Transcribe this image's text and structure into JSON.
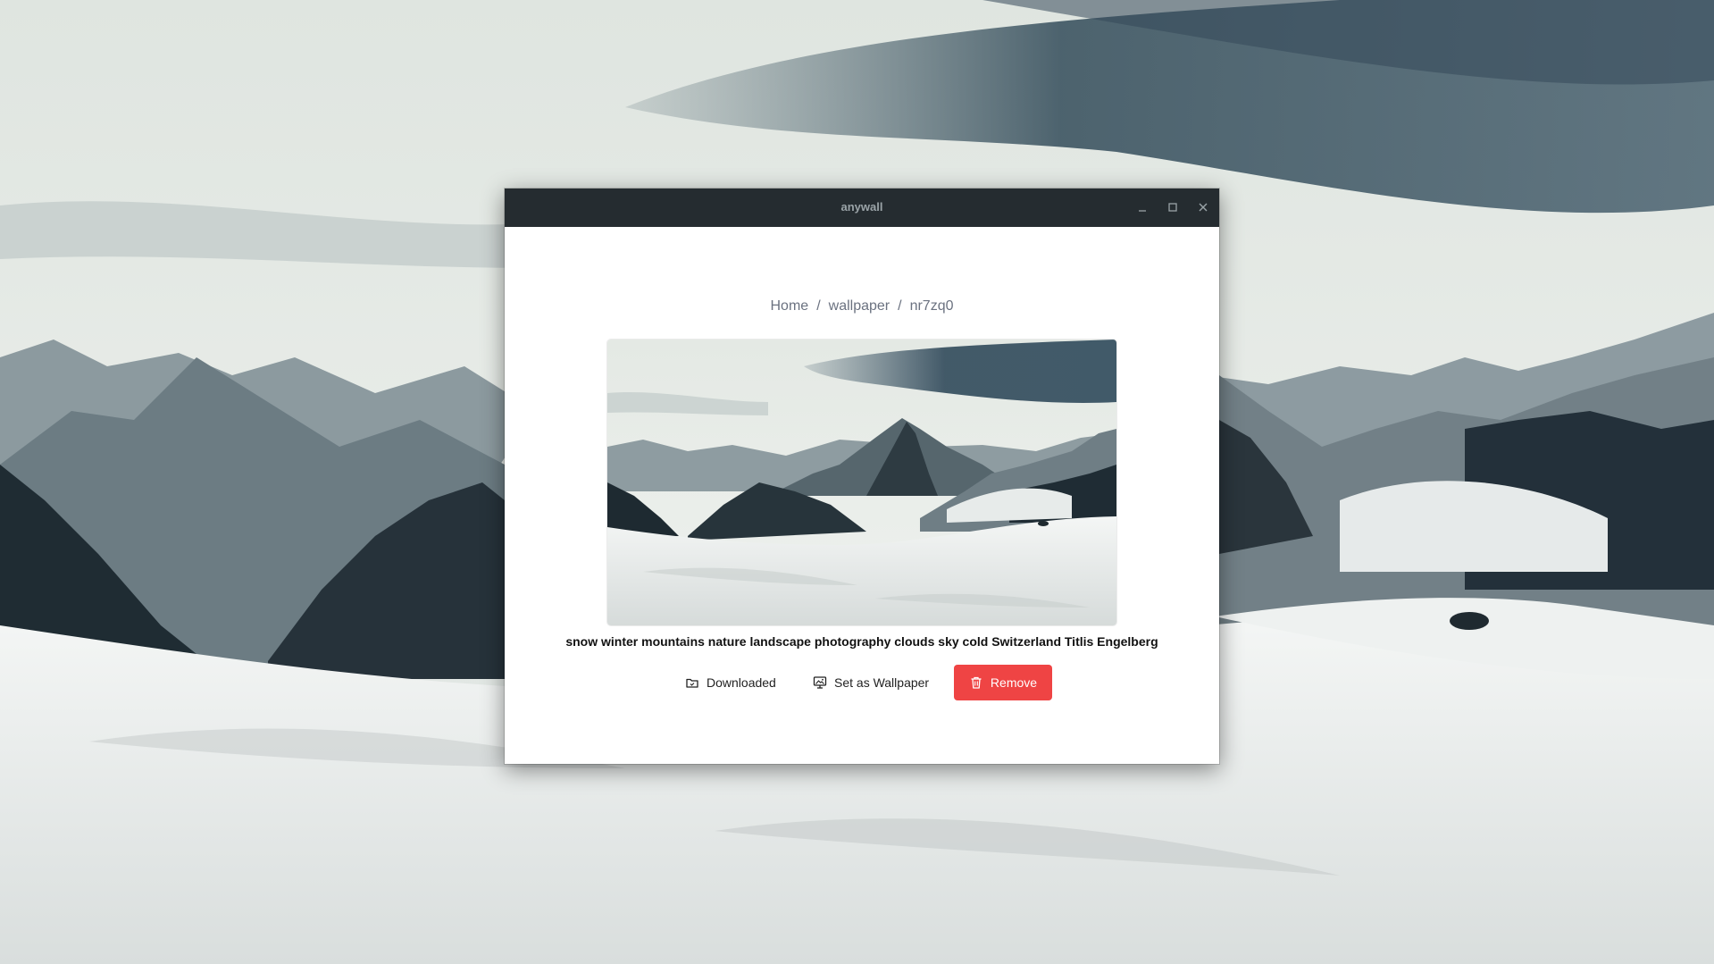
{
  "window": {
    "title": "anywall"
  },
  "breadcrumb": {
    "items": [
      "Home",
      "wallpaper",
      "nr7zq0"
    ],
    "separator": "/"
  },
  "wallpaper": {
    "tags": "snow winter mountains nature landscape photography clouds sky cold Switzerland Titlis Engelberg"
  },
  "actions": {
    "downloaded_label": "Downloaded",
    "downloaded_icon": "folder-icon",
    "set_wallpaper_label": "Set as Wallpaper",
    "set_wallpaper_icon": "monitor-image-icon",
    "remove_label": "Remove",
    "remove_icon": "trash-icon"
  },
  "colors": {
    "titlebar": "#252c30",
    "remove_button": "#ef4444",
    "breadcrumb_text": "#6b7280"
  }
}
